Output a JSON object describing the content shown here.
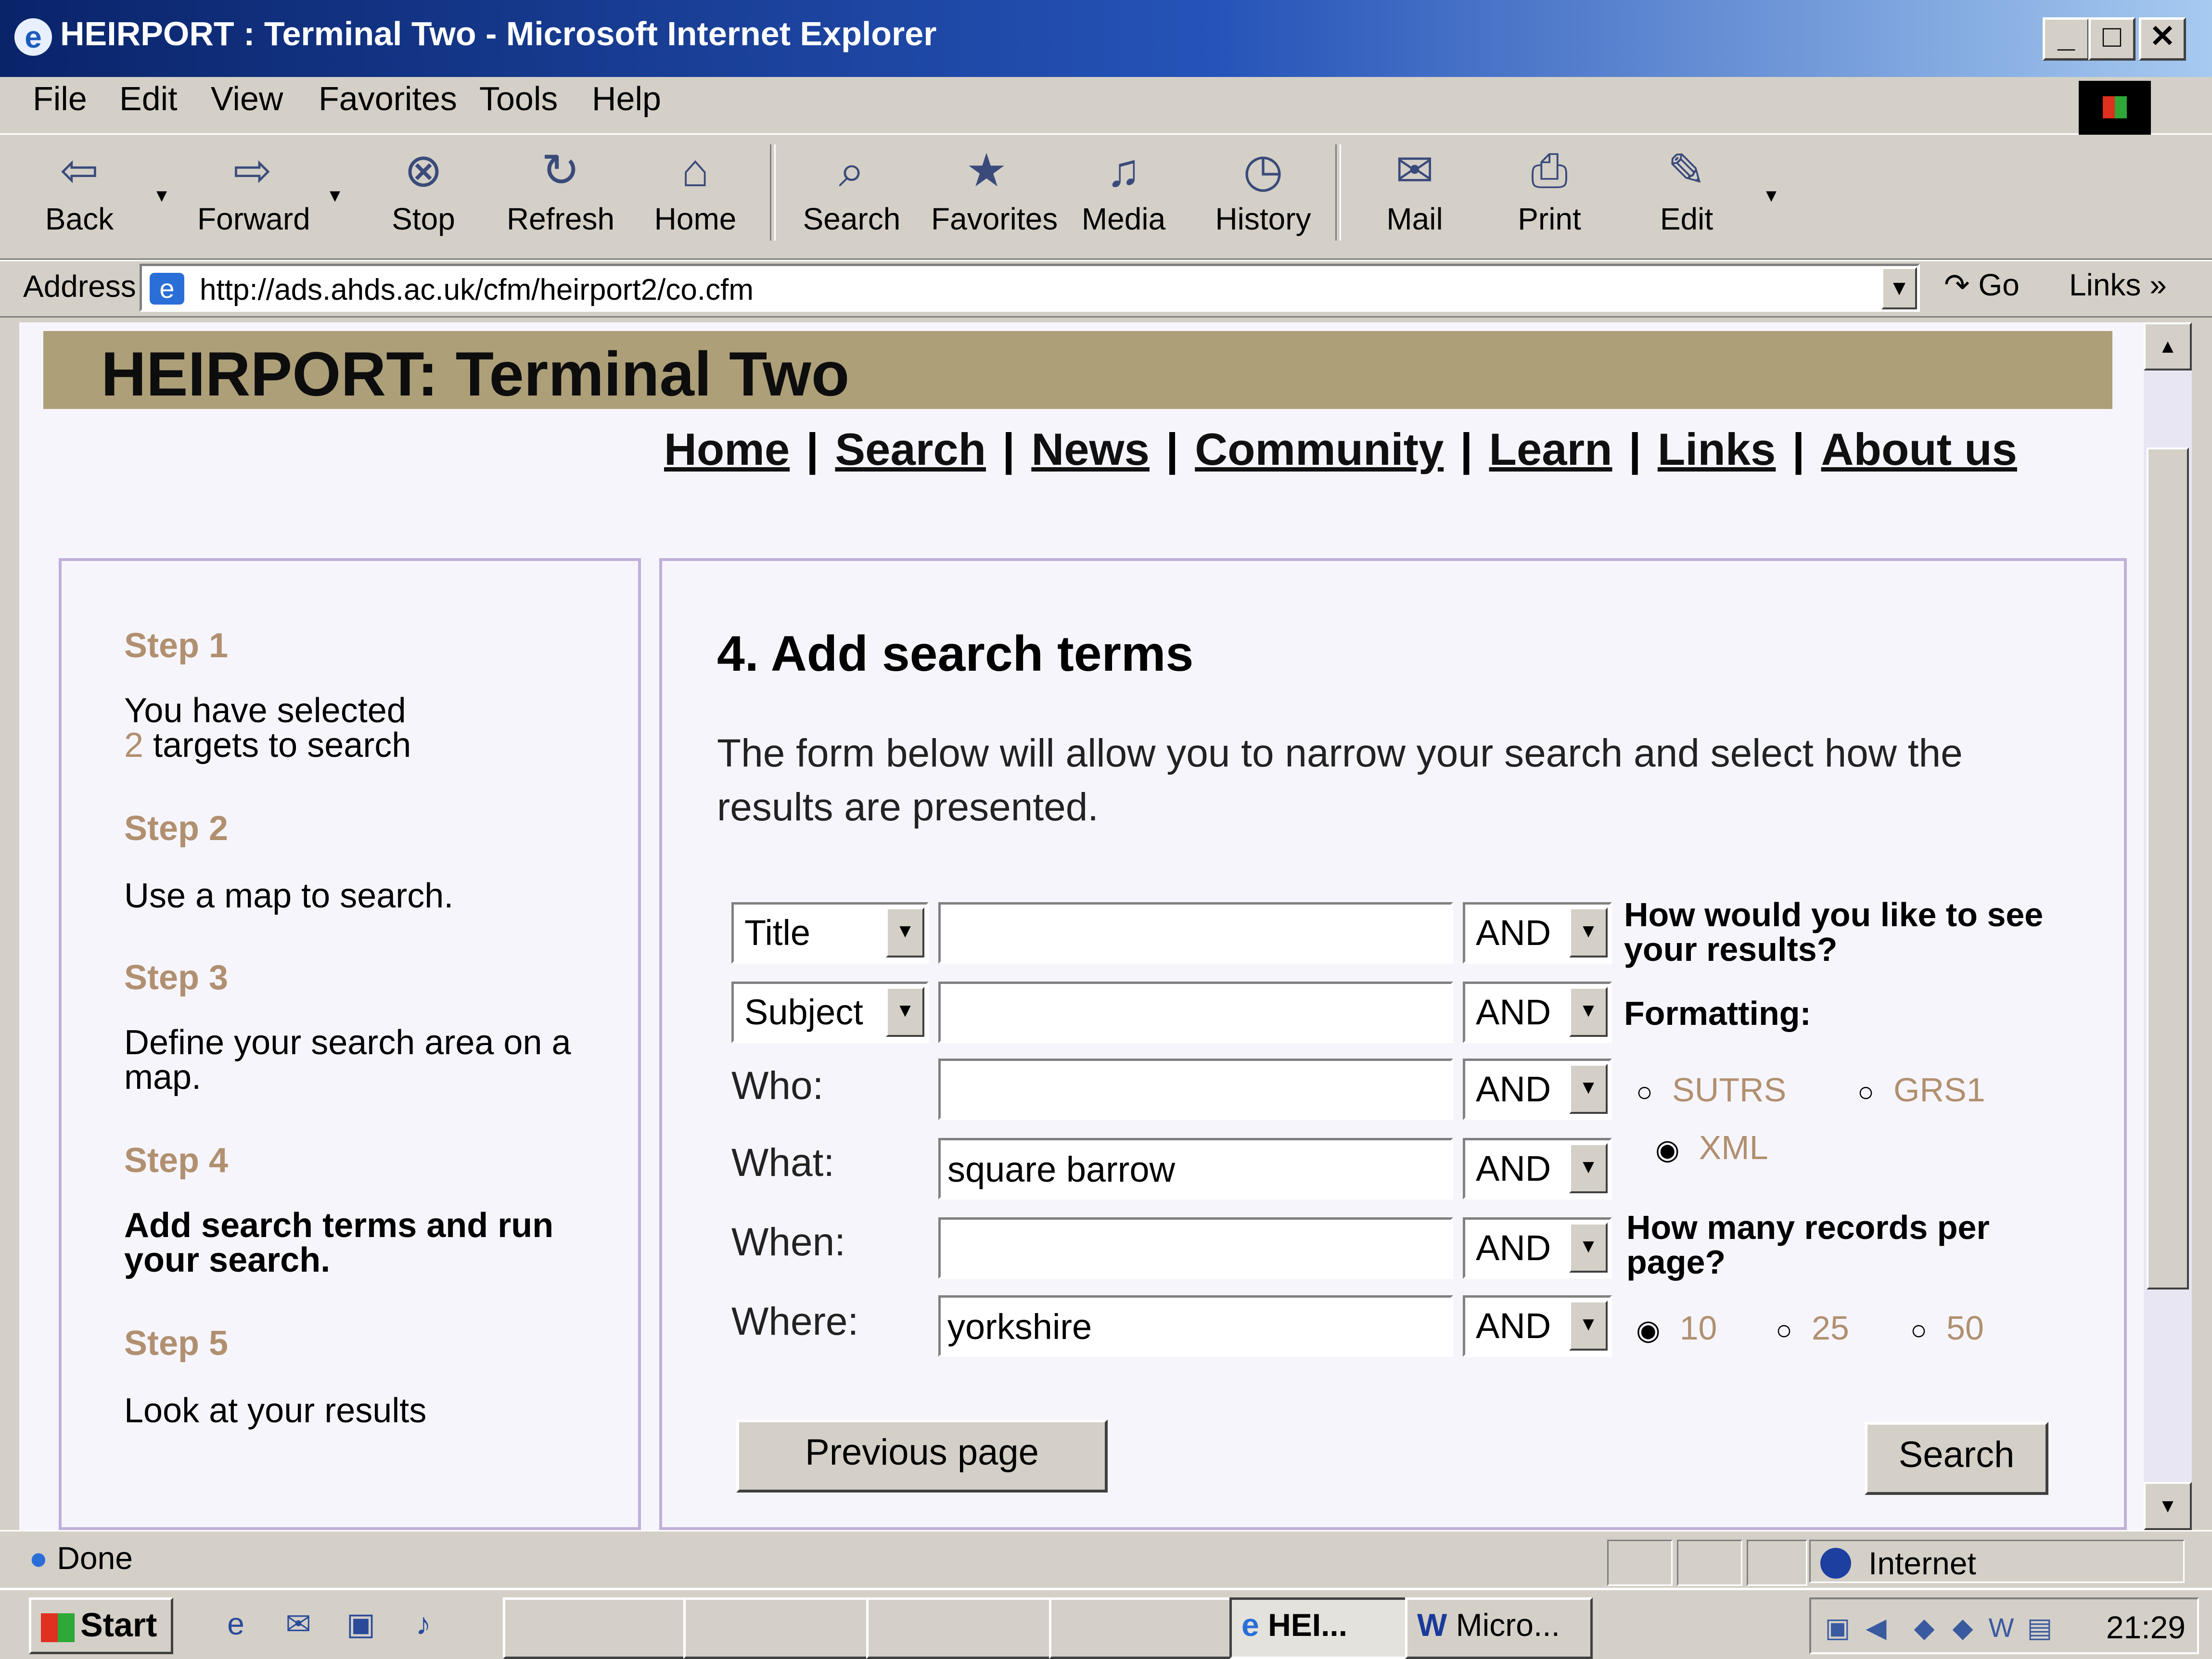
{
  "window": {
    "title": "HEIRPORT : Terminal Two - Microsoft Internet Explorer",
    "buttons": {
      "minimize": "_",
      "maximize": "□",
      "close": "✕"
    }
  },
  "menu": [
    "File",
    "Edit",
    "View",
    "Favorites",
    "Tools",
    "Help"
  ],
  "toolbar": {
    "back": "Back",
    "forward": "Forward",
    "stop": "Stop",
    "refresh": "Refresh",
    "home": "Home",
    "search": "Search",
    "favorites": "Favorites",
    "media": "Media",
    "history": "History",
    "mail": "Mail",
    "print": "Print",
    "edit": "Edit"
  },
  "address": {
    "label": "Address",
    "url": "http://ads.ahds.ac.uk/cfm/heirport2/co.cfm",
    "go": "Go",
    "links": "Links"
  },
  "page": {
    "banner_title": "HEIRPORT: Terminal Two",
    "nav": [
      "Home",
      "Search",
      "News",
      "Community",
      "Learn",
      "Links",
      "About us"
    ],
    "steps": [
      {
        "title": "Step 1",
        "text_a": "You have selected",
        "count": "2",
        "text_b": "targets to search"
      },
      {
        "title": "Step 2",
        "text": "Use a map to search."
      },
      {
        "title": "Step 3",
        "text": "Define your search area on a map."
      },
      {
        "title": "Step 4",
        "text": "Add search terms and run your search."
      },
      {
        "title": "Step 5",
        "text": "Look at your results"
      }
    ],
    "heading": "4. Add search terms",
    "intro": "The form below will allow you to narrow your search and select how the results are presented.",
    "rows": [
      {
        "field_select": "Title",
        "value": "",
        "operator": "AND"
      },
      {
        "field_select": "Subject",
        "value": "",
        "operator": "AND"
      },
      {
        "label": "Who:",
        "value": "",
        "operator": "AND"
      },
      {
        "label": "What:",
        "value": "square barrow",
        "operator": "AND"
      },
      {
        "label": "When:",
        "value": "",
        "operator": "AND"
      },
      {
        "label": "Where:",
        "value": "yorkshire",
        "operator": "AND"
      }
    ],
    "results_question": "How would you like to see your results?",
    "formatting_label": "Formatting:",
    "format_options": [
      "SUTRS",
      "GRS1",
      "XML"
    ],
    "format_selected": "XML",
    "records_question": "How many records per page?",
    "records_options": [
      "10",
      "25",
      "50"
    ],
    "records_selected": "10",
    "previous_button": "Previous page",
    "search_button": "Search"
  },
  "status": {
    "text": "Done",
    "zone": "Internet"
  },
  "taskbar": {
    "start": "Start",
    "tasks": [
      "HEI...",
      "Micro..."
    ],
    "clock": "21:29"
  }
}
